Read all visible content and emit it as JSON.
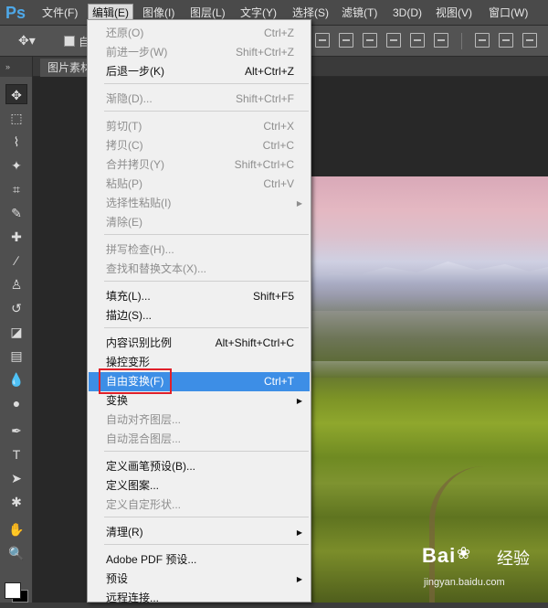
{
  "app": {
    "logo": "Ps"
  },
  "menubar": {
    "items": [
      {
        "label": "文件(F)"
      },
      {
        "label": "编辑(E)"
      },
      {
        "label": "图像(I)"
      },
      {
        "label": "图层(L)"
      },
      {
        "label": "文字(Y)"
      },
      {
        "label": "选择(S)"
      },
      {
        "label": "滤镜(T)"
      },
      {
        "label": "3D(D)"
      },
      {
        "label": "视图(V)"
      },
      {
        "label": "窗口(W)"
      }
    ]
  },
  "options": {
    "auto_select_label": "自"
  },
  "tabs": {
    "doc_label": "图片素材"
  },
  "menu": {
    "items": [
      {
        "label": "还原(O)",
        "shortcut": "Ctrl+Z",
        "enabled": false
      },
      {
        "label": "前进一步(W)",
        "shortcut": "Shift+Ctrl+Z",
        "enabled": false
      },
      {
        "label": "后退一步(K)",
        "shortcut": "Alt+Ctrl+Z",
        "enabled": true
      },
      {
        "label": "渐隐(D)...",
        "shortcut": "Shift+Ctrl+F",
        "enabled": false
      },
      {
        "label": "剪切(T)",
        "shortcut": "Ctrl+X",
        "enabled": false
      },
      {
        "label": "拷贝(C)",
        "shortcut": "Ctrl+C",
        "enabled": false
      },
      {
        "label": "合并拷贝(Y)",
        "shortcut": "Shift+Ctrl+C",
        "enabled": false
      },
      {
        "label": "粘贴(P)",
        "shortcut": "Ctrl+V",
        "enabled": false
      },
      {
        "label": "选择性粘贴(I)",
        "shortcut": "",
        "enabled": false,
        "submenu": true
      },
      {
        "label": "清除(E)",
        "shortcut": "",
        "enabled": false
      },
      {
        "label": "拼写检查(H)...",
        "shortcut": "",
        "enabled": false
      },
      {
        "label": "查找和替换文本(X)...",
        "shortcut": "",
        "enabled": false
      },
      {
        "label": "填充(L)...",
        "shortcut": "Shift+F5",
        "enabled": true
      },
      {
        "label": "描边(S)...",
        "shortcut": "",
        "enabled": true
      },
      {
        "label": "内容识别比例",
        "shortcut": "Alt+Shift+Ctrl+C",
        "enabled": true
      },
      {
        "label": "操控变形",
        "shortcut": "",
        "enabled": true
      },
      {
        "label": "自由变换(F)",
        "shortcut": "Ctrl+T",
        "enabled": true,
        "highlighted": true
      },
      {
        "label": "变换",
        "shortcut": "",
        "enabled": true,
        "submenu": true
      },
      {
        "label": "自动对齐图层...",
        "shortcut": "",
        "enabled": false
      },
      {
        "label": "自动混合图层...",
        "shortcut": "",
        "enabled": false
      },
      {
        "label": "定义画笔预设(B)...",
        "shortcut": "",
        "enabled": true
      },
      {
        "label": "定义图案...",
        "shortcut": "",
        "enabled": true
      },
      {
        "label": "定义自定形状...",
        "shortcut": "",
        "enabled": false
      },
      {
        "label": "清理(R)",
        "shortcut": "",
        "enabled": true,
        "submenu": true
      },
      {
        "label": "Adobe PDF 预设...",
        "shortcut": "",
        "enabled": true
      },
      {
        "label": "预设",
        "shortcut": "",
        "enabled": true,
        "submenu": true
      },
      {
        "label": "远程连接...",
        "shortcut": "",
        "enabled": true
      }
    ]
  },
  "watermark": {
    "logo": "Bai",
    "logo2": "经验",
    "url": "jingyan.baidu.com"
  },
  "colors": {
    "highlight": "#3d8ee6",
    "callout": "#e0202a",
    "menu_bg": "#f0f0f0"
  }
}
